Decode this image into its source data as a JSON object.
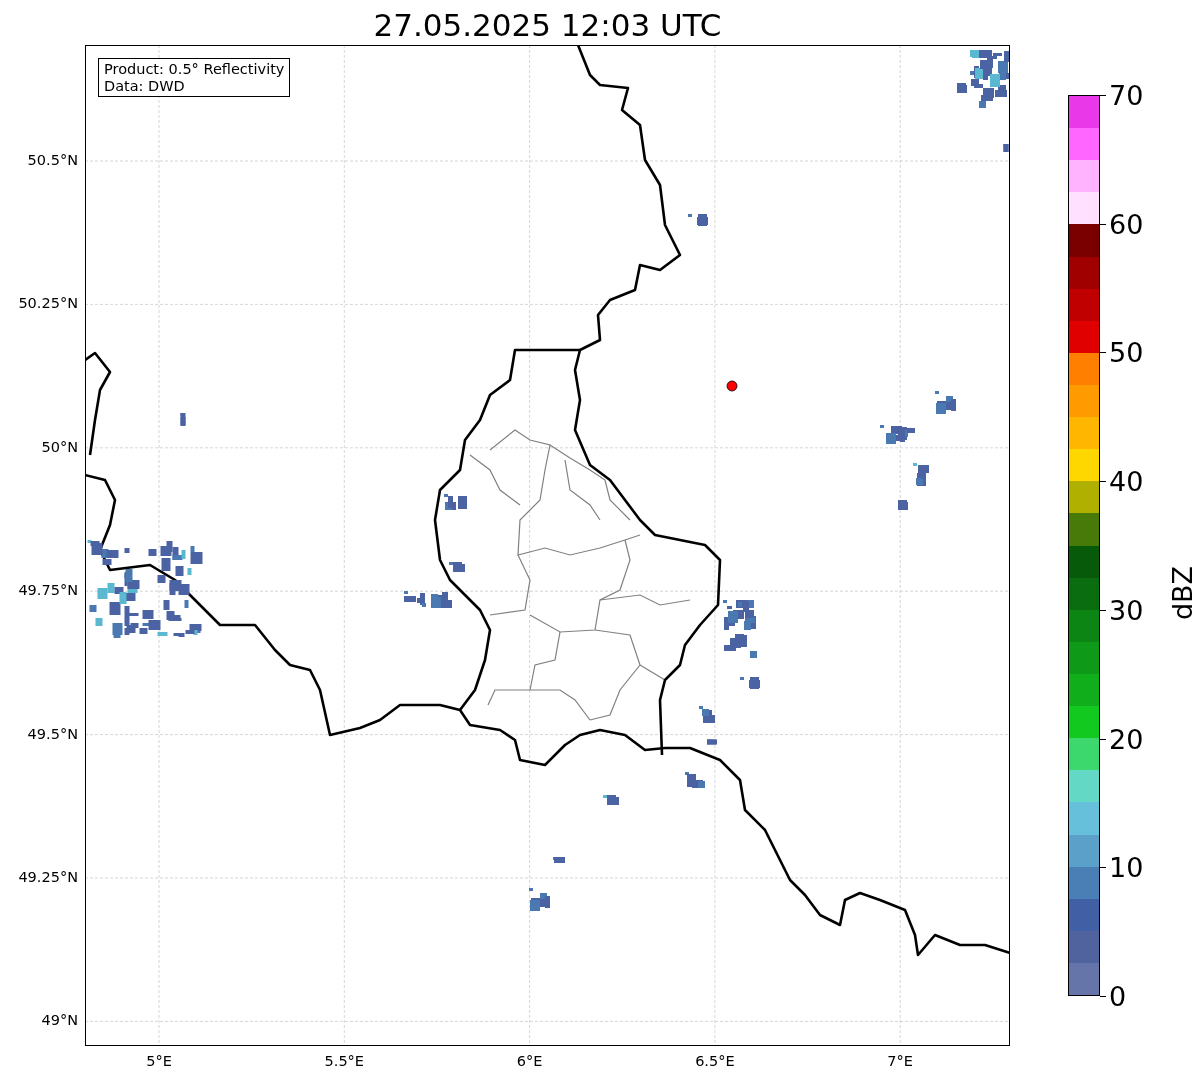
{
  "title": "27.05.2025 12:03 UTC",
  "info_box": {
    "lines": [
      "Product: 0.5° Reflectivity",
      "Data: DWD"
    ]
  },
  "map": {
    "lat_labels": [
      "50.5°N",
      "50.25°N",
      "50°N",
      "49.75°N",
      "49.5°N",
      "49.25°N",
      "49°N"
    ],
    "lon_labels": [
      "5°E",
      "5.5°E",
      "6°E",
      "6.5°E",
      "7°E"
    ]
  },
  "colorbar": {
    "label": "dBZ",
    "segments": [
      {
        "color": "#e838e8"
      },
      {
        "color": "#ff66ff"
      },
      {
        "color": "#ffb3ff"
      },
      {
        "color": "#ffe0ff"
      },
      {
        "color": "#7a0000"
      },
      {
        "color": "#a00000"
      },
      {
        "color": "#c00000"
      },
      {
        "color": "#e00000"
      },
      {
        "color": "#ff7f00"
      },
      {
        "color": "#ff9a00"
      },
      {
        "color": "#ffb600"
      },
      {
        "color": "#ffd700"
      },
      {
        "color": "#b0b000"
      },
      {
        "color": "#487a0a"
      },
      {
        "color": "#075a0a"
      },
      {
        "color": "#0a6e10"
      },
      {
        "color": "#0c8514"
      },
      {
        "color": "#0e9a18"
      },
      {
        "color": "#10ae1b"
      },
      {
        "color": "#12c91f"
      },
      {
        "color": "#3dd86d"
      },
      {
        "color": "#63d8c4"
      },
      {
        "color": "#66c0dc"
      },
      {
        "color": "#5aa0c8"
      },
      {
        "color": "#4a7fb5"
      },
      {
        "color": "#405fa5"
      },
      {
        "color": "#50639e"
      },
      {
        "color": "#6575aa"
      }
    ],
    "tick_labels": [
      "70",
      "60",
      "50",
      "40",
      "30",
      "20",
      "10",
      "0"
    ]
  }
}
